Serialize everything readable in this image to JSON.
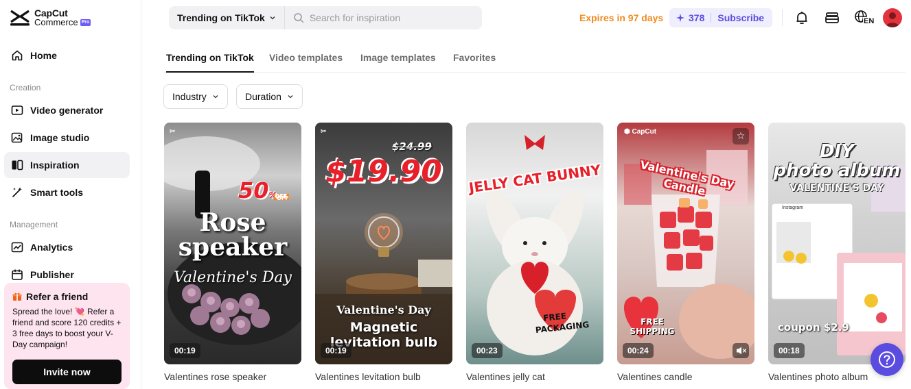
{
  "brand": {
    "line1": "CapCut",
    "line2": "Commerce",
    "badge": "Pro"
  },
  "sidebar": {
    "home": "Home",
    "section_creation": "Creation",
    "creation_items": [
      {
        "label": "Video generator",
        "icon": "video-plus-icon"
      },
      {
        "label": "Image studio",
        "icon": "image-edit-icon"
      },
      {
        "label": "Inspiration",
        "icon": "inspiration-icon",
        "active": true
      },
      {
        "label": "Smart tools",
        "icon": "magic-wand-icon"
      }
    ],
    "section_management": "Management",
    "management_items": [
      {
        "label": "Analytics",
        "icon": "chart-line-icon"
      },
      {
        "label": "Publisher",
        "icon": "calendar-icon"
      }
    ],
    "refer": {
      "title": "Refer a friend",
      "body": "Spread the love! 💘 Refer a friend and score 120 credits + 3 free days to boost your V-Day campaign!",
      "button": "Invite now"
    }
  },
  "topbar": {
    "search_scope": "Trending on TikTok",
    "search_placeholder": "Search for inspiration",
    "expires": "Expires in 97 days",
    "credits": "378",
    "subscribe": "Subscribe",
    "language": "EN"
  },
  "tabs": [
    "Trending on TikTok",
    "Video templates",
    "Image templates",
    "Favorites"
  ],
  "filters": [
    "Industry",
    "Duration"
  ],
  "cards": [
    {
      "title": "Valentines rose speaker",
      "duration": "00:19",
      "overlay": {
        "discount": "50",
        "discount_unit": "%",
        "discount_label": "OFF",
        "headline_1": "Rose",
        "headline_2": "speaker",
        "script": "Valentine's Day"
      }
    },
    {
      "title": "Valentines levitation bulb",
      "duration": "00:19",
      "overlay": {
        "old_price": "$24.99",
        "price": "$19.90",
        "caption_1": "Valentine's Day",
        "caption_2": "Magnetic",
        "caption_3": "levitation bulb"
      }
    },
    {
      "title": "Valentines jelly cat",
      "duration": "00:23",
      "overlay": {
        "headline": "JELLY CAT BUNNY",
        "badge_1": "FREE",
        "badge_2": "PACKAGING"
      }
    },
    {
      "title": "Valentines candle",
      "duration": "00:24",
      "overlay": {
        "logo": "CapCut",
        "headline": "Valentine's Day Candle",
        "badge_1": "FREE",
        "badge_2": "SHIPPING"
      }
    },
    {
      "title": "Valentines photo album",
      "duration": "00:18",
      "overlay": {
        "headline_1": "DIY",
        "headline_2": "photo album",
        "headline_3": "VALENTINE'S DAY",
        "coupon": "coupon $2.9",
        "app_label": "Instagram"
      }
    }
  ],
  "colors": {
    "accent": "#5b4ce0",
    "expires": "#f08a1c",
    "refer_bg": "#fde4ee"
  }
}
